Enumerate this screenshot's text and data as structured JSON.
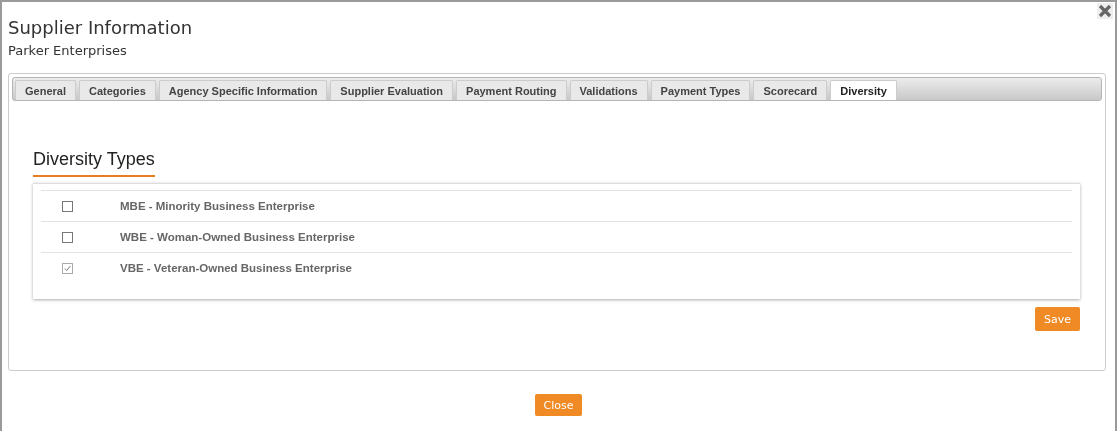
{
  "dialog": {
    "title": "Supplier Information",
    "subtitle": "Parker Enterprises"
  },
  "tabs": [
    {
      "label": "General",
      "selected": false
    },
    {
      "label": "Categories",
      "selected": false
    },
    {
      "label": "Agency Specific Information",
      "selected": false
    },
    {
      "label": "Supplier Evaluation",
      "selected": false
    },
    {
      "label": "Payment Routing",
      "selected": false
    },
    {
      "label": "Validations",
      "selected": false
    },
    {
      "label": "Payment Types",
      "selected": false
    },
    {
      "label": "Scorecard",
      "selected": false
    },
    {
      "label": "Diversity",
      "selected": true
    }
  ],
  "section": {
    "heading": "Diversity Types"
  },
  "diversity_types": [
    {
      "label": "MBE - Minority Business Enterprise",
      "checked": false
    },
    {
      "label": "WBE - Woman-Owned Business Enterprise",
      "checked": false
    },
    {
      "label": "VBE - Veteran-Owned Business Enterprise",
      "checked": true
    }
  ],
  "buttons": {
    "save": "Save",
    "close": "Close"
  }
}
